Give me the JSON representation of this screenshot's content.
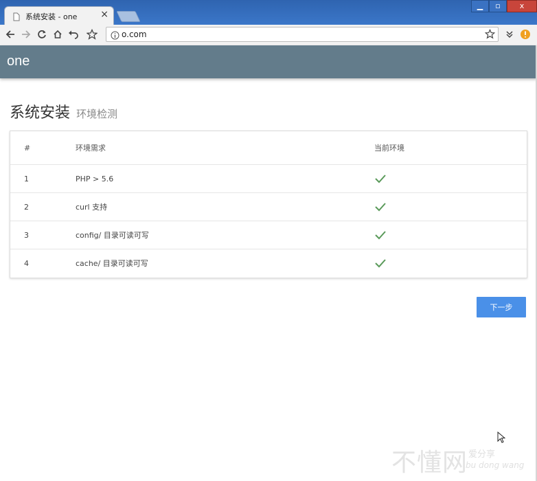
{
  "browser": {
    "tab_title": "系统安装 - one",
    "tab_close": "×",
    "address": "o.com",
    "window_buttons": [
      "▁",
      "▫",
      "x"
    ]
  },
  "app": {
    "title": "one"
  },
  "page": {
    "heading": "系统安装",
    "subheading": "环境检测"
  },
  "table": {
    "columns": [
      "#",
      "环境需求",
      "当前环境"
    ],
    "rows": [
      {
        "index": "1",
        "requirement": "PHP > 5.6",
        "status": "check"
      },
      {
        "index": "2",
        "requirement": "curl 支持",
        "status": "check"
      },
      {
        "index": "3",
        "requirement": "config/ 目录可读可写",
        "status": "check"
      },
      {
        "index": "4",
        "requirement": "cache/ 目录可读可写",
        "status": "check"
      }
    ]
  },
  "actions": {
    "next_label": "下一步"
  },
  "watermark": {
    "big": "不懂网",
    "small1": "爱分享",
    "small2": "bu dong wang"
  },
  "colors": {
    "header": "#637c8b",
    "button": "#4a90e8",
    "check": "#5a9a5a",
    "titlebar": "#2f64b0"
  },
  "icons": [
    "page-icon",
    "back-icon",
    "forward-icon",
    "reload-icon",
    "home-icon",
    "undo-icon",
    "star-icon",
    "info-icon",
    "menu-icon",
    "extension-icon",
    "check-icon",
    "cursor-icon"
  ]
}
